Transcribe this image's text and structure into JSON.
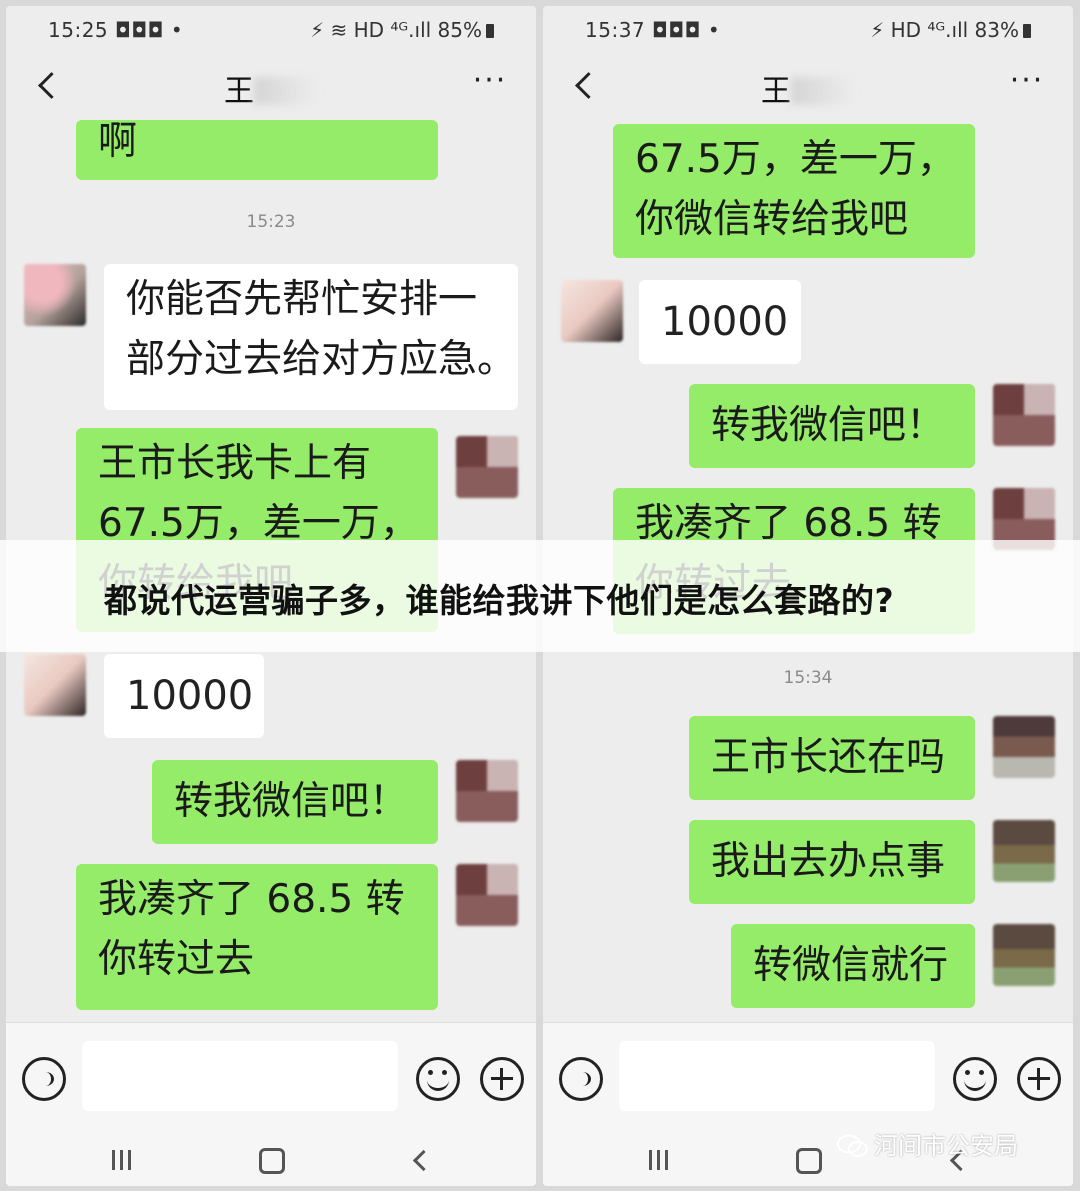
{
  "colors": {
    "sent_bubble": "#95ec69",
    "received_bubble": "#ffffff",
    "chat_bg": "#ededed"
  },
  "banner": {
    "text": "都说代运营骗子多，谁能给我讲下他们是怎么套路的?"
  },
  "watermark": {
    "text": "河间市公安局",
    "icon": "wechat-icon"
  },
  "left": {
    "status": {
      "time": "15:25 ◘◘◘ •",
      "icons": "⚡ ≋ HD ⁴ᴳ.ıll",
      "battery": "85%"
    },
    "nav": {
      "title": "王",
      "more": "···"
    },
    "messages": {
      "m1": "啊",
      "ts1": "15:23",
      "m2": "你能否先帮忙安排一\n部分过去给对方应急。",
      "m3": "王市长我卡上有\n67.5万，差一万，\n你转给我吧",
      "m4": "10000",
      "m5": "转我微信吧！",
      "m6": "我凑齐了 68.5 转\n你转过去"
    }
  },
  "right": {
    "status": {
      "time": "15:37 ◘◘◘ •",
      "icons": "⚡ HD ⁴ᴳ.ıll",
      "battery": "83%"
    },
    "nav": {
      "title": "王",
      "more": "···"
    },
    "messages": {
      "m1": "67.5万，差一万，\n你微信转给我吧",
      "m2": "10000",
      "m3": "转我微信吧！",
      "m4": "我凑齐了 68.5 转\n你转过去",
      "ts1": "15:34",
      "m5": "王市长还在吗",
      "m6": "我出去办点事",
      "m7": "转微信就行"
    }
  }
}
